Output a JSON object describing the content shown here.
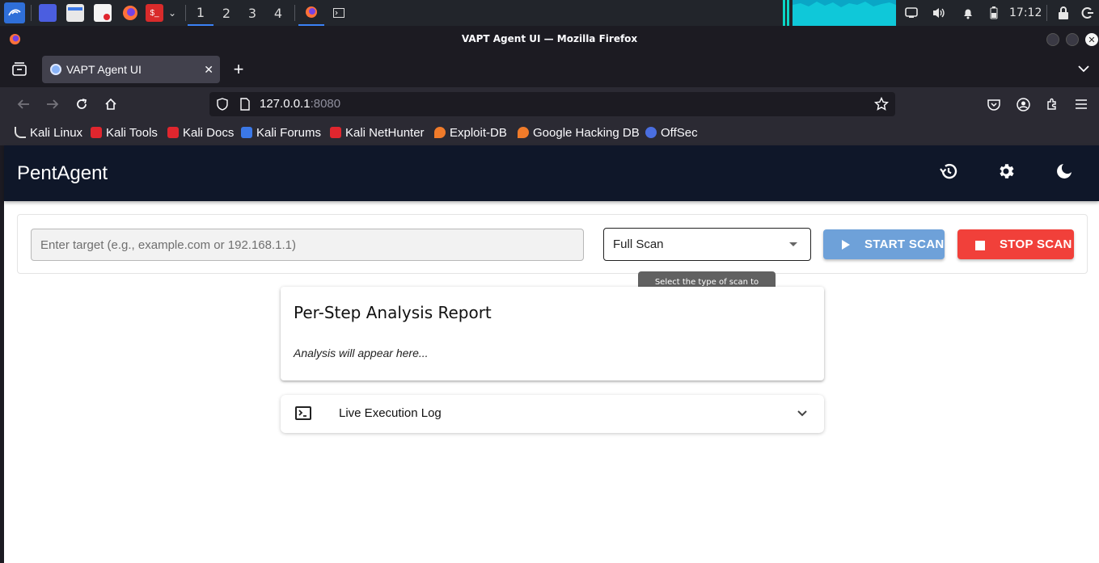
{
  "taskbar": {
    "workspaces": [
      "1",
      "2",
      "3",
      "4"
    ],
    "active_workspace": "1",
    "clock": "17:12"
  },
  "window": {
    "title": "VAPT Agent UI — Mozilla Firefox"
  },
  "browser": {
    "tab_title": "VAPT Agent UI",
    "new_tab": "+",
    "tab_close": "✕",
    "url_host": "127.0.0.1",
    "url_port": ":8080",
    "bookmarks": [
      {
        "label": "Kali Linux",
        "icon": "kali-dragon-icon",
        "color": "#e6e6e6"
      },
      {
        "label": "Kali Tools",
        "icon": "kali-tools-icon",
        "color": "#e0262e"
      },
      {
        "label": "Kali Docs",
        "icon": "kali-docs-icon",
        "color": "#e0262e"
      },
      {
        "label": "Kali Forums",
        "icon": "kali-forums-icon",
        "color": "#3b78e7"
      },
      {
        "label": "Kali NetHunter",
        "icon": "kali-nethunter-icon",
        "color": "#e0262e"
      },
      {
        "label": "Exploit-DB",
        "icon": "exploit-db-icon",
        "color": "#f07b2a"
      },
      {
        "label": "Google Hacking DB",
        "icon": "ghdb-icon",
        "color": "#f07b2a"
      },
      {
        "label": "OffSec",
        "icon": "offsec-icon",
        "color": "#4a6ee0"
      }
    ]
  },
  "app": {
    "title": "PentAgent",
    "header_bg": "#0f1729",
    "target": {
      "value": "",
      "placeholder": "Enter target (e.g., example.com or 192.168.1.1)"
    },
    "scan_type": {
      "selected": "Full Scan",
      "tooltip": "Select the type of scan to perform"
    },
    "start_label": "START SCAN",
    "stop_label": "STOP SCAN",
    "start_color": "#6ea1d9",
    "stop_color": "#f1403a",
    "report": {
      "title": "Per-Step Analysis Report",
      "body": "Analysis will appear here..."
    },
    "log": {
      "title": "Live Execution Log"
    }
  }
}
